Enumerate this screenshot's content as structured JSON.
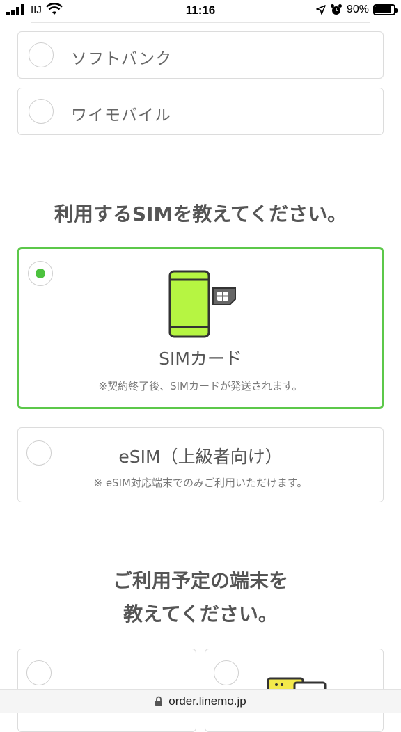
{
  "status_bar": {
    "carrier": "IIJ",
    "time": "11:16",
    "battery": "90%",
    "battery_level": 0.9
  },
  "carriers": [
    {
      "label": "ソフトバンク",
      "selected": false
    },
    {
      "label": "ワイモバイル",
      "selected": false
    }
  ],
  "sim_section": {
    "title": "利用するSIMを教えてください。",
    "options": [
      {
        "label": "SIMカード",
        "note": "※契約終了後、SIMカードが発送されます。",
        "selected": true
      },
      {
        "label": "eSIM（上級者向け）",
        "note": "※ eSIM対応端末でのみご利用いただけます。",
        "selected": false
      }
    ]
  },
  "device_section": {
    "title_line1": "ご利用予定の端末を",
    "title_line2": "教えてください。"
  },
  "url_bar": {
    "url": "order.linemo.jp"
  },
  "colors": {
    "accent_green": "#5cc84a",
    "phone_screen": "#b6f542",
    "device_yellow": "#f3e94c"
  }
}
